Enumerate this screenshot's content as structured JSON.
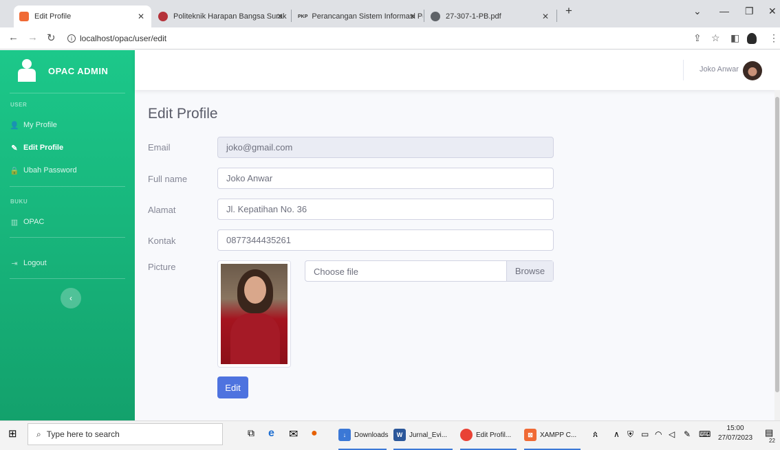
{
  "browser": {
    "tabs": [
      {
        "title": "Edit Profile",
        "active": true
      },
      {
        "title": "Politeknik Harapan Bangsa Surak",
        "active": false
      },
      {
        "title": "Perancangan Sistem Informasi Pe",
        "active": false
      },
      {
        "title": "27-307-1-PB.pdf",
        "active": false
      }
    ],
    "pkp_badge": "PKP",
    "url": "localhost/opac/user/edit"
  },
  "sidebar": {
    "brand": "OPAC ADMIN",
    "heading_user": "USER",
    "item_my_profile": "My Profile",
    "item_edit_profile": "Edit Profile",
    "item_ubah_password": "Ubah Password",
    "heading_buku": "BUKU",
    "item_opac": "OPAC",
    "item_logout": "Logout"
  },
  "topbar": {
    "user_name": "Joko Anwar"
  },
  "form": {
    "title": "Edit Profile",
    "email_label": "Email",
    "email_value": "joko@gmail.com",
    "fullname_label": "Full name",
    "fullname_value": "Joko Anwar",
    "alamat_label": "Alamat",
    "alamat_value": "Jl. Kepatihan No. 36",
    "kontak_label": "Kontak",
    "kontak_value": "0877344435261",
    "picture_label": "Picture",
    "file_placeholder": "Choose file",
    "browse_label": "Browse",
    "submit_label": "Edit"
  },
  "taskbar": {
    "search_placeholder": "Type here to search",
    "apps": [
      "Downloads",
      "Jurnal_Evi...",
      "Edit Profil...",
      "XAMPP C..."
    ],
    "time": "15:00",
    "date": "27/07/2023",
    "notification_count": "22"
  },
  "colors": {
    "sidebar": "#1cc88a",
    "primary": "#4e73df"
  }
}
